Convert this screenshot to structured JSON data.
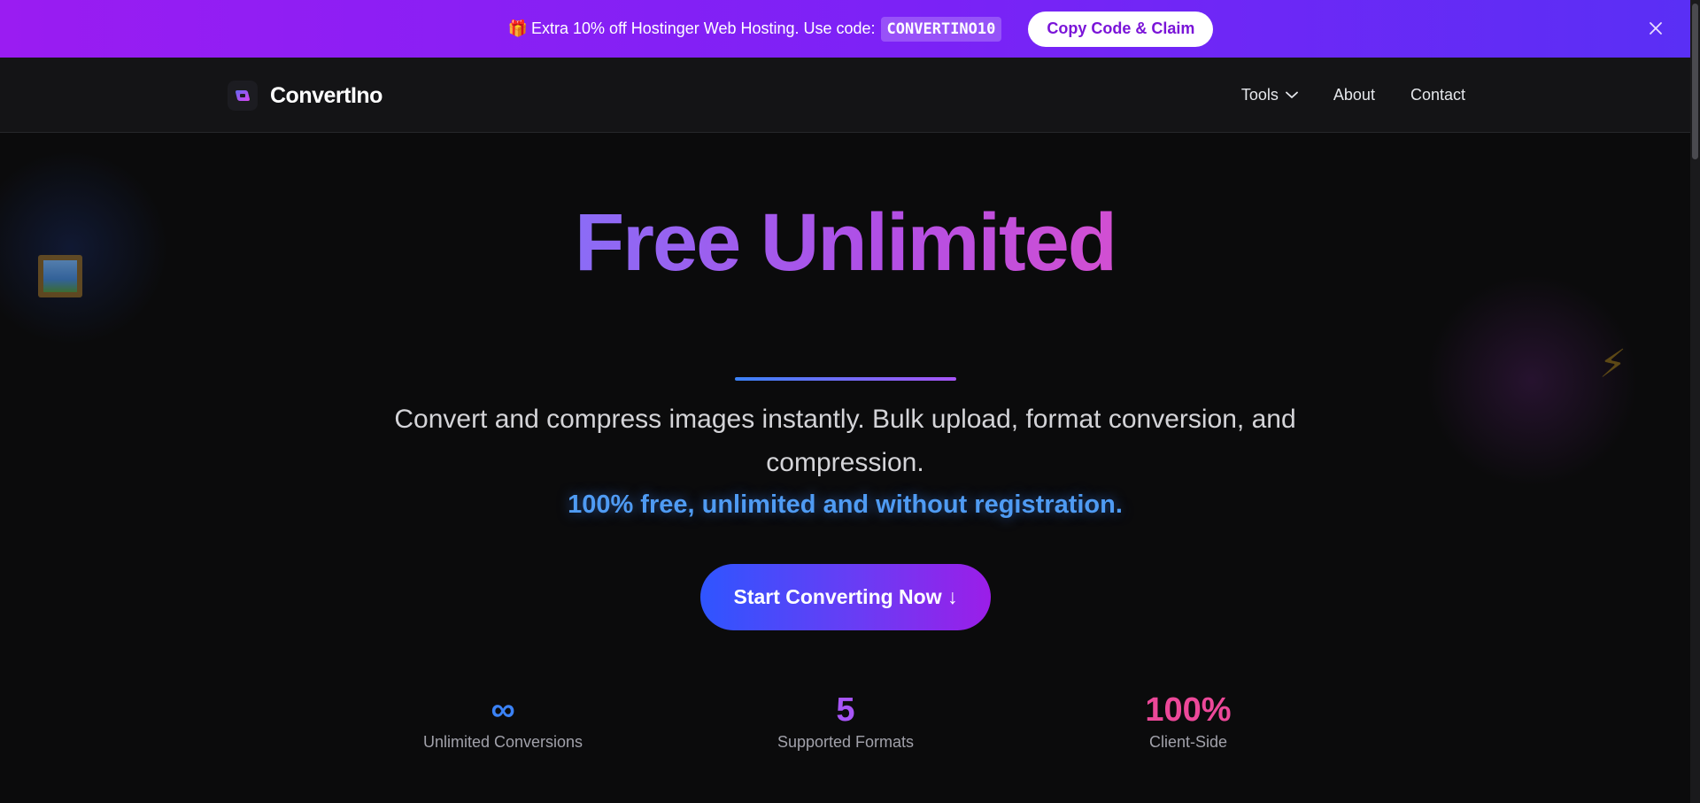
{
  "promo": {
    "gift_icon": "🎁",
    "text": "Extra 10% off Hostinger Web Hosting. Use code:",
    "code": "CONVERTINO10",
    "button_label": "Copy Code & Claim",
    "close_icon": "close-icon"
  },
  "nav": {
    "brand_name": "ConvertIno",
    "links": [
      {
        "label": "Tools",
        "has_dropdown": true
      },
      {
        "label": "About"
      },
      {
        "label": "Contact"
      }
    ]
  },
  "hero": {
    "title": "Free Unlimited",
    "subtitle": "Convert and compress images instantly. Bulk upload, format conversion, and compression.",
    "free_text": "100% free, unlimited and without registration.",
    "cta_label": "Start Converting Now ↓"
  },
  "stats": [
    {
      "value": "∞",
      "label": "Unlimited Conversions",
      "color": "#3b82f6"
    },
    {
      "value": "5",
      "label": "Supported Formats",
      "color": "#a855f7"
    },
    {
      "value": "100%",
      "label": "Client-Side",
      "color": "#ec4899"
    }
  ],
  "colors": {
    "promo_start": "#9a1cf2",
    "promo_end": "#5a2ff5",
    "accent_blue": "#4f9bf3",
    "accent_purple": "#a855f7",
    "background": "#0b0b0c"
  },
  "decorations": {
    "left_icon": "framed-picture-icon",
    "right_icon": "lightning-bolt-icon",
    "bolt_glyph": "⚡"
  }
}
